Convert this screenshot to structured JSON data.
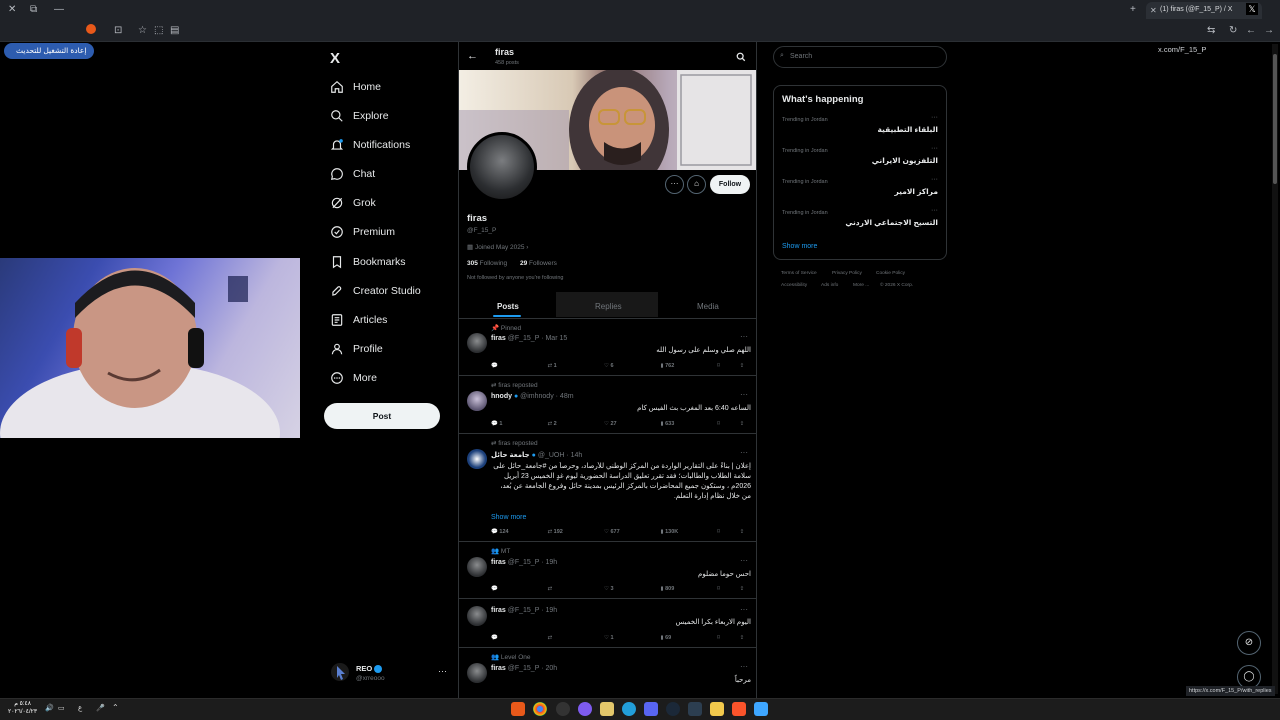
{
  "browser": {
    "tab_title": "(1) firas (@F_15_P) / X",
    "update_button": "إعادة التشغيل للتحديث",
    "url": "x.com/F_15_P",
    "status_url": "https://x.com/F_15_P/with_replies"
  },
  "nav": {
    "logo": "X",
    "items": [
      {
        "label": "Home",
        "icon": "home-icon"
      },
      {
        "label": "Explore",
        "icon": "search-icon"
      },
      {
        "label": "Notifications",
        "icon": "bell-icon"
      },
      {
        "label": "Chat",
        "icon": "chat-icon"
      },
      {
        "label": "Grok",
        "icon": "grok-icon"
      },
      {
        "label": "Premium",
        "icon": "premium-icon"
      },
      {
        "label": "Bookmarks",
        "icon": "bookmark-icon"
      },
      {
        "label": "Creator Studio",
        "icon": "rocket-icon"
      },
      {
        "label": "Articles",
        "icon": "articles-icon"
      },
      {
        "label": "Profile",
        "icon": "person-icon"
      },
      {
        "label": "More",
        "icon": "more-icon"
      }
    ],
    "post_button": "Post",
    "account": {
      "name": "REO",
      "handle": "@xrreooo"
    }
  },
  "profile": {
    "header_name": "firas",
    "header_posts": "458 posts",
    "name": "firas",
    "handle": "@F_15_P",
    "joined": "Joined May 2025",
    "following_count": "305",
    "following_label": "Following",
    "followers_count": "29",
    "followers_label": "Followers",
    "not_followed": "Not followed by anyone you're following",
    "follow_button": "Follow"
  },
  "tabs": [
    "Posts",
    "Replies",
    "Media"
  ],
  "tweets": [
    {
      "context": "Pinned",
      "name": "firas",
      "handle": "@F_15_P · Mar 15",
      "text": "اللهم صلي وسلم على رسول الله",
      "replies": "",
      "reposts": "1",
      "likes": "6",
      "views": "762"
    },
    {
      "context": "firas reposted",
      "name": "hnody",
      "handle": "@imhnody · 48m",
      "text": "الساعه 6:40 بعد المغرب بث الفيس كام",
      "replies": "1",
      "reposts": "2",
      "likes": "27",
      "views": "633"
    },
    {
      "context": "firas reposted",
      "name": "جامعة حائل",
      "handle": "@_UOH · 14h",
      "text": "إعلان | بناءً على التقارير الواردة من المركز الوطني للأرصاد، وحرصاً من #جامعة_حائل على سلامة الطلاب والطالبات؛ فقد تقرر تعليق الدراسة الحضورية ليوم غدٍ الخميس 23 أبريل 2026م ، وستكون جميع المحاضرات بالمركز الرئيس بمدينة حائل وفروع الجامعة عن بُعد، من خلال نظام إدارة التعلم.",
      "show_more": "Show more",
      "replies": "124",
      "reposts": "192",
      "likes": "677",
      "views": "130K"
    },
    {
      "context": "MT",
      "name": "firas",
      "handle": "@F_15_P · 19h",
      "text": "احس حوما مضلوم",
      "replies": "",
      "reposts": "",
      "likes": "3",
      "views": "809"
    },
    {
      "context": "",
      "name": "firas",
      "handle": "@F_15_P · 19h",
      "text": "اليوم الاربعاء بكرا الخميس",
      "replies": "",
      "reposts": "",
      "likes": "1",
      "views": "69"
    },
    {
      "context": "Level One",
      "name": "firas",
      "handle": "@F_15_P · 20h",
      "text": "مرحباً",
      "replies": "",
      "reposts": "",
      "likes": "",
      "views": ""
    }
  ],
  "right": {
    "search_placeholder": "Search",
    "trends_title": "What's happening",
    "trends": [
      {
        "meta": "Trending in Jordan",
        "name": "البلقاء التطبيقية"
      },
      {
        "meta": "Trending in Jordan",
        "name": "التلفزيون الايراني"
      },
      {
        "meta": "Trending in Jordan",
        "name": "مراكز الامير"
      },
      {
        "meta": "Trending in Jordan",
        "name": "التسيح الاجتماعي الاردني"
      }
    ],
    "show_more": "Show more",
    "footer": [
      "Terms of Service",
      "Privacy Policy",
      "Cookie Policy",
      "Accessibility",
      "Ads info",
      "More ...",
      "© 2026 X Corp."
    ]
  },
  "taskbar": {
    "time": "٥:٤٨ م",
    "date": "٢٠٢٦/٠٤/٢٣",
    "lang": "ع"
  }
}
